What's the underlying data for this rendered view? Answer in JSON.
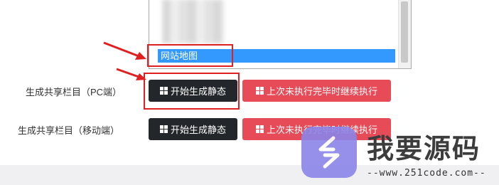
{
  "listbox": {
    "selected_option": "网站地图"
  },
  "rows": [
    {
      "label": "生成共享栏目（PC端）",
      "primary_button": "开始生成静态",
      "secondary_button": "上次未执行完毕时继续执行"
    },
    {
      "label": "生成共享栏目（移动端）",
      "primary_button": "开始生成静态",
      "secondary_button": "上次未执行完毕时继续执行"
    }
  ],
  "watermark": {
    "brand": "我要源码",
    "url": "--www.251code.com--"
  },
  "colors": {
    "dark_button": "#23272b",
    "red_button": "#e64b57",
    "selection": "#3399ff",
    "highlight": "#e02020",
    "logo": "#8b85e8"
  }
}
